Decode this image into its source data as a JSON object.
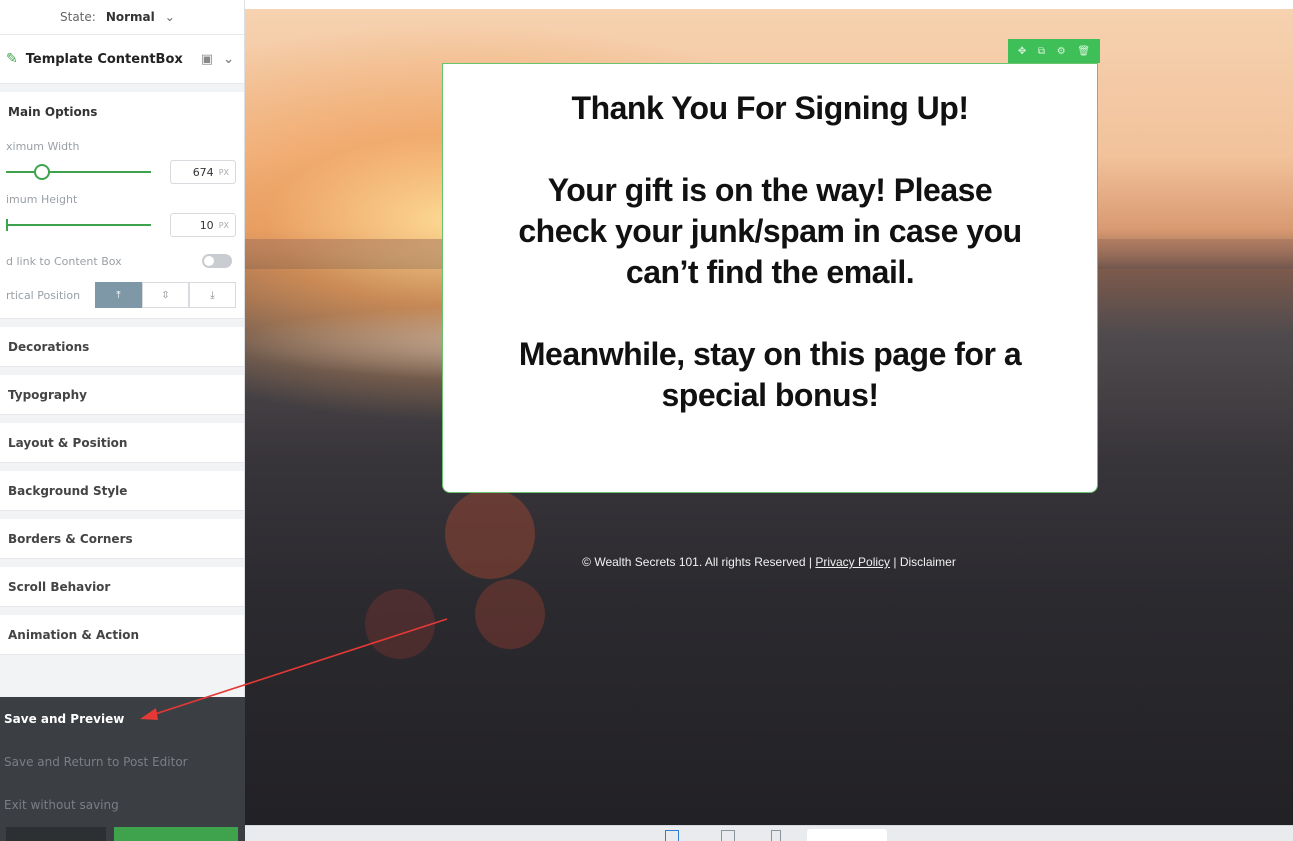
{
  "sidebar": {
    "state_label": "State:",
    "state_value": "Normal",
    "template_title": "Template ContentBox",
    "main_options": {
      "title": "Main Options",
      "max_width_label": "ximum Width",
      "max_width_value": "674",
      "max_width_unit": "PX",
      "min_height_label": "imum Height",
      "min_height_value": "10",
      "min_height_unit": "PX",
      "link_label": "d link to Content Box",
      "link_enabled": false,
      "vertical_position_label": "rtical Position",
      "vertical_position_selected": "top"
    },
    "sections": [
      "Decorations",
      "Typography",
      "Layout & Position",
      "Background Style",
      "Borders & Corners",
      "Scroll Behavior",
      "Animation & Action"
    ]
  },
  "save_menu": {
    "save_preview": "Save and Preview",
    "save_return": "Save and Return to Post Editor",
    "exit": "Exit without saving"
  },
  "content_box": {
    "lines": [
      "Thank You For Signing Up!",
      "",
      "Your gift is on the way! Please",
      "check your junk/spam in case you",
      "can’t find the email.",
      "",
      "Meanwhile, stay on this page for a",
      "special bonus!"
    ]
  },
  "footer": {
    "copyright": "© Wealth Secrets 101. All rights Reserved | ",
    "privacy": "Privacy Policy",
    "separator": " | ",
    "disclaimer": "Disclaimer"
  },
  "colors": {
    "accent_green": "#3fa34d",
    "save_menu_bg": "#3b3e42",
    "annotation_arrow": "#e53935"
  },
  "icons": {
    "toolbar": [
      "move-icon",
      "duplicate-icon",
      "settings-icon",
      "delete-icon"
    ]
  }
}
